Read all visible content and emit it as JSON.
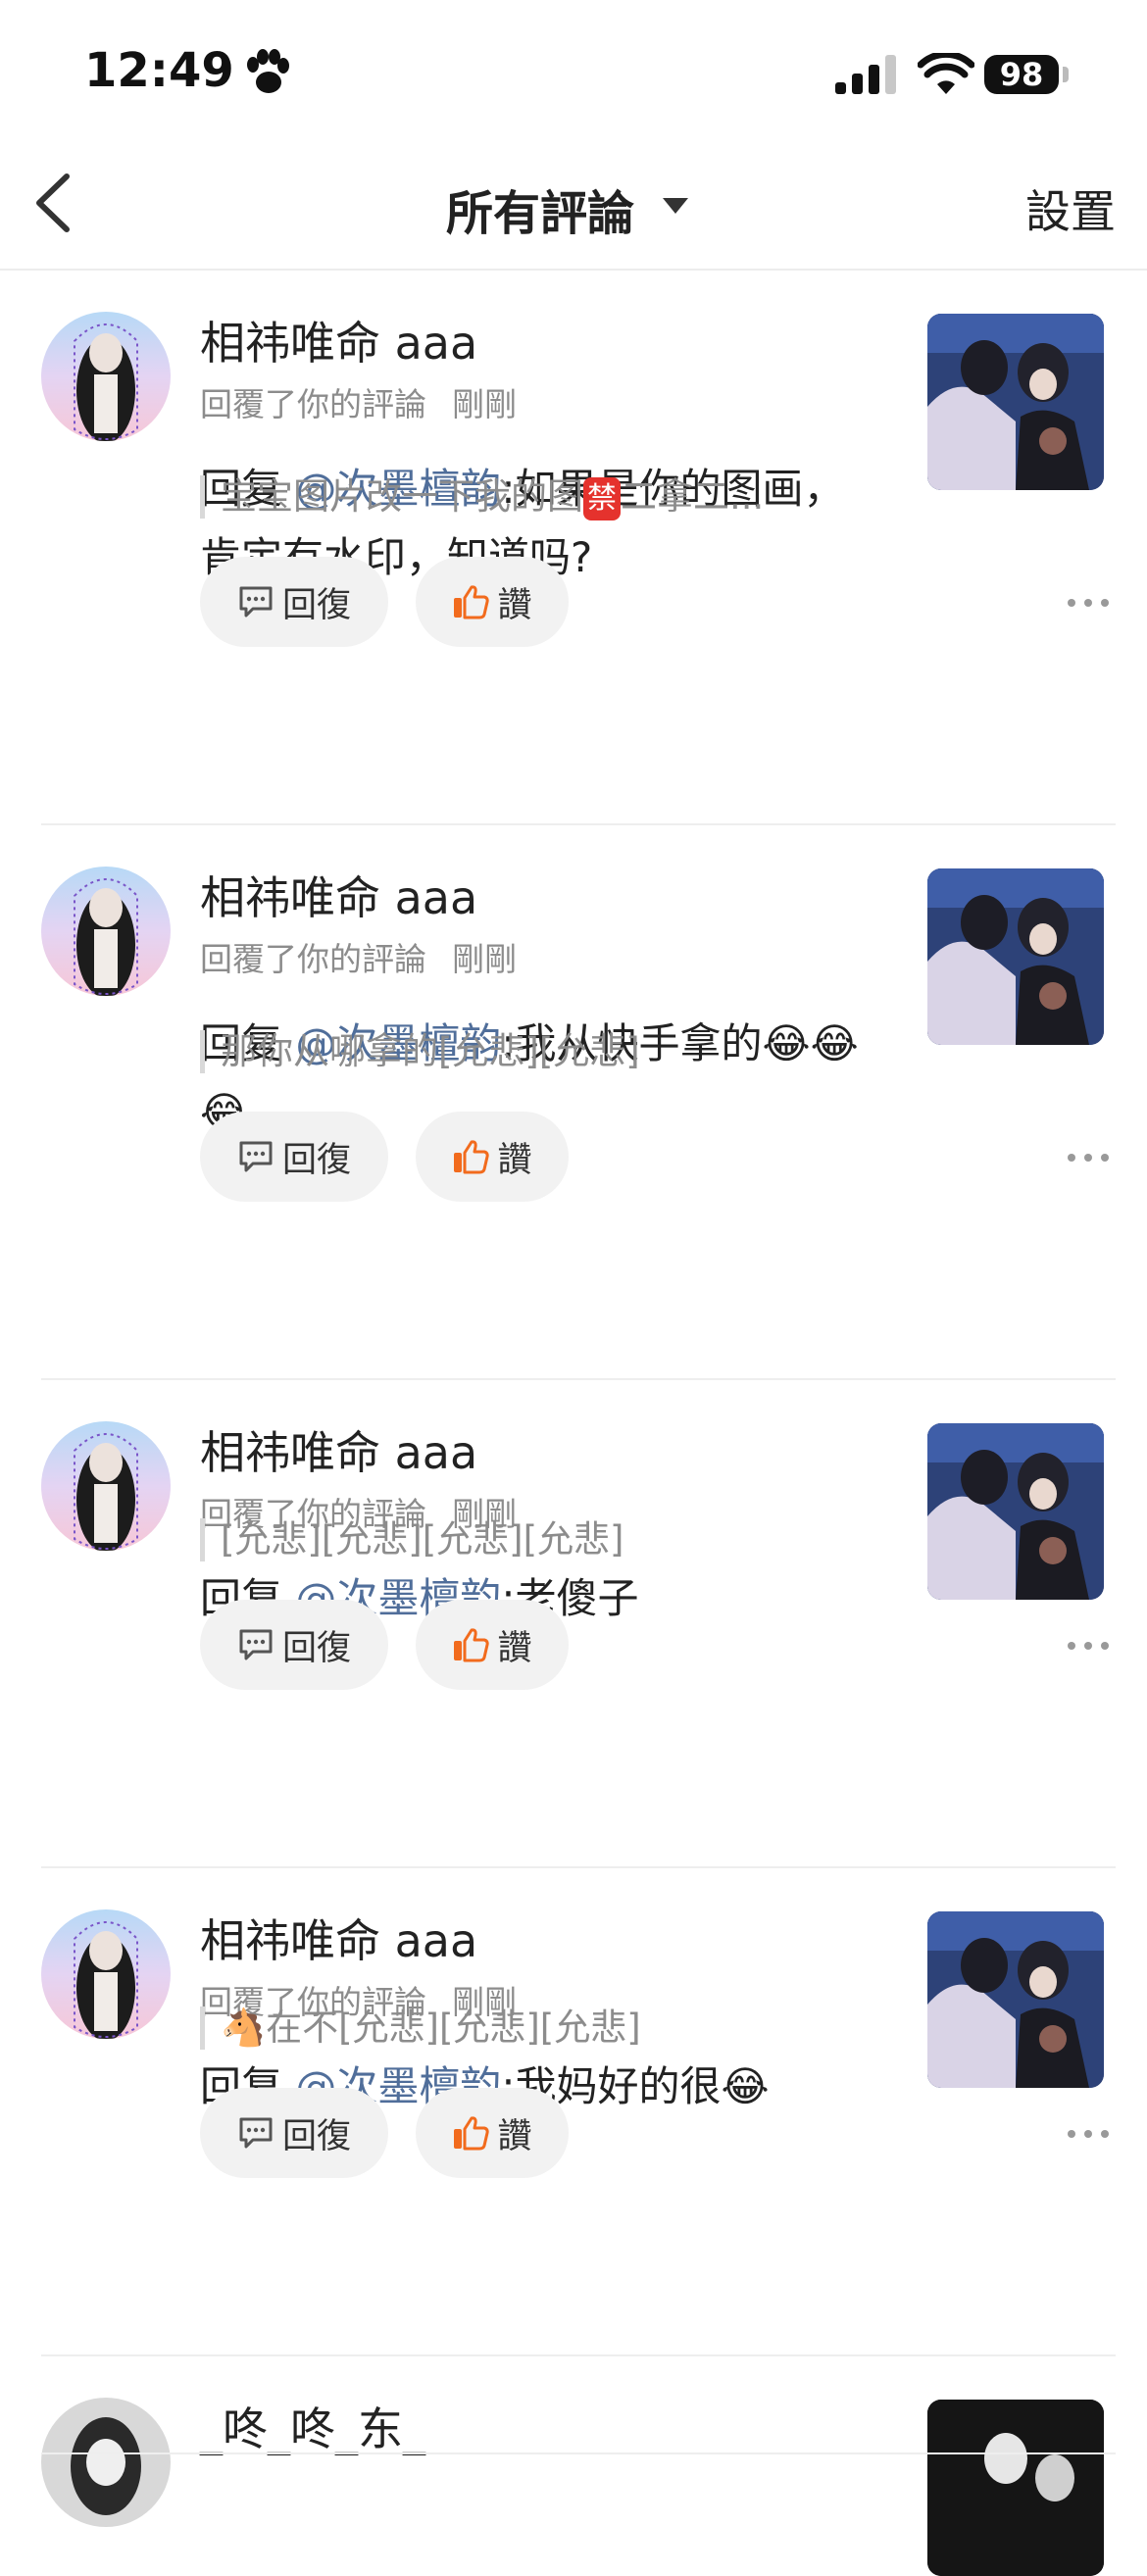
{
  "status_bar": {
    "time": "12:49",
    "battery": "98"
  },
  "nav": {
    "title": "所有評論",
    "settings": "設置"
  },
  "comments": [
    {
      "username": "相祎唯命 aaa",
      "action": "回覆了你的評論",
      "time": "剛剛",
      "prefix": "回复 ",
      "mention": "@次墨檀韵",
      "text": ":如果是你的图画，肯定有水印，知道吗?",
      "quote_a": "宝宝图片改一下我的图",
      "quote_badge": "禁",
      "quote_b": "二拿二...",
      "reply_label": "回復",
      "like_label": "讚"
    },
    {
      "username": "相祎唯命 aaa",
      "action": "回覆了你的評論",
      "time": "剛剛",
      "prefix": "回复 ",
      "mention": "@次墨檀韵",
      "text": ":我从快手拿的😂😂😂",
      "quote_a": "那你从哪拿的[允悲][允悲]",
      "reply_label": "回復",
      "like_label": "讚"
    },
    {
      "username": "相祎唯命 aaa",
      "action": "回覆了你的評論",
      "time": "剛剛",
      "prefix": "回复 ",
      "mention": "@次墨檀韵",
      "text": ":老傻子",
      "quote_a": "[允悲][允悲][允悲][允悲]",
      "reply_label": "回復",
      "like_label": "讚"
    },
    {
      "username": "相祎唯命 aaa",
      "action": "回覆了你的評論",
      "time": "剛剛",
      "prefix": "回复 ",
      "mention": "@次墨檀韵",
      "text": ":我妈好的很😂",
      "quote_a": "🐴在不[允悲][允悲][允悲]",
      "reply_label": "回復",
      "like_label": "讚"
    },
    {
      "username": "_咚_咚_东_"
    }
  ],
  "colors": {
    "mention": "#506e9a",
    "like_icon": "#f26b1d",
    "background": "#ffffff"
  },
  "icons": [
    "paw-icon",
    "signal-icon",
    "wifi-icon",
    "battery-icon",
    "back-icon",
    "caret-down-icon",
    "comment-icon",
    "thumbs-up-icon",
    "more-icon"
  ]
}
